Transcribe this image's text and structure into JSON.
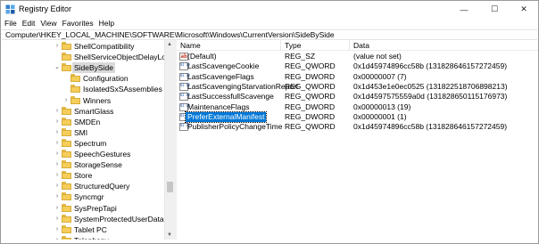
{
  "window": {
    "title": "Registry Editor",
    "minimize_glyph": "—",
    "maximize_glyph": "☐",
    "close_glyph": "✕"
  },
  "menu": [
    "File",
    "Edit",
    "View",
    "Favorites",
    "Help"
  ],
  "address": "Computer\\HKEY_LOCAL_MACHINE\\SOFTWARE\\Microsoft\\Windows\\CurrentVersion\\SideBySide",
  "tree": {
    "items": [
      {
        "label": "ShellCompatibility",
        "level": 0,
        "expandable": true,
        "expanded": false,
        "selected": false
      },
      {
        "label": "ShellServiceObjectDelayLoad",
        "level": 0,
        "expandable": false,
        "expanded": false,
        "selected": false
      },
      {
        "label": "SideBySide",
        "level": 0,
        "expandable": true,
        "expanded": true,
        "selected": true
      },
      {
        "label": "Configuration",
        "level": 1,
        "expandable": false,
        "expanded": false,
        "selected": false
      },
      {
        "label": "IsolatedSxSAssemblies",
        "level": 1,
        "expandable": false,
        "expanded": false,
        "selected": false
      },
      {
        "label": "Winners",
        "level": 1,
        "expandable": true,
        "expanded": false,
        "selected": false
      },
      {
        "label": "SmartGlass",
        "level": 0,
        "expandable": true,
        "expanded": false,
        "selected": false
      },
      {
        "label": "SMDEn",
        "level": 0,
        "expandable": true,
        "expanded": false,
        "selected": false
      },
      {
        "label": "SMI",
        "level": 0,
        "expandable": true,
        "expanded": false,
        "selected": false
      },
      {
        "label": "Spectrum",
        "level": 0,
        "expandable": true,
        "expanded": false,
        "selected": false
      },
      {
        "label": "SpeechGestures",
        "level": 0,
        "expandable": true,
        "expanded": false,
        "selected": false
      },
      {
        "label": "StorageSense",
        "level": 0,
        "expandable": true,
        "expanded": false,
        "selected": false
      },
      {
        "label": "Store",
        "level": 0,
        "expandable": true,
        "expanded": false,
        "selected": false
      },
      {
        "label": "StructuredQuery",
        "level": 0,
        "expandable": true,
        "expanded": false,
        "selected": false
      },
      {
        "label": "Syncmgr",
        "level": 0,
        "expandable": true,
        "expanded": false,
        "selected": false
      },
      {
        "label": "SysPrepTapi",
        "level": 0,
        "expandable": true,
        "expanded": false,
        "selected": false
      },
      {
        "label": "SystemProtectedUserData",
        "level": 0,
        "expandable": true,
        "expanded": false,
        "selected": false
      },
      {
        "label": "Tablet PC",
        "level": 0,
        "expandable": true,
        "expanded": false,
        "selected": false
      },
      {
        "label": "Telephony",
        "level": 0,
        "expandable": true,
        "expanded": false,
        "selected": false
      }
    ]
  },
  "list": {
    "columns": [
      "Name",
      "Type",
      "Data"
    ],
    "rows": [
      {
        "name": "(Default)",
        "type": "REG_SZ",
        "data": "(value not set)",
        "icon": "string-value-icon",
        "selected": false
      },
      {
        "name": "LastScavengeCookie",
        "type": "REG_QWORD",
        "data": "0x1d45974896cc58b (1318286461572724​59)",
        "icon": "binary-value-icon",
        "selected": false
      },
      {
        "name": "LastScavengeFlags",
        "type": "REG_DWORD",
        "data": "0x00000007 (7)",
        "icon": "binary-value-icon",
        "selected": false
      },
      {
        "name": "LastScavengingStarvationReport",
        "type": "REG_QWORD",
        "data": "0x1d453e1e0ec0525 (131822518706898213)",
        "icon": "binary-value-icon",
        "selected": false
      },
      {
        "name": "LastSuccessfullScavenge",
        "type": "REG_QWORD",
        "data": "0x1d4597575559a0d (131828650115176973)",
        "icon": "binary-value-icon",
        "selected": false
      },
      {
        "name": "MaintenanceFlags",
        "type": "REG_DWORD",
        "data": "0x00000013 (19)",
        "icon": "binary-value-icon",
        "selected": false
      },
      {
        "name": "PreferExternalManifest",
        "type": "REG_DWORD",
        "data": "0x00000001 (1)",
        "icon": "binary-value-icon",
        "selected": true
      },
      {
        "name": "PublisherPolicyChangeTime",
        "type": "REG_QWORD",
        "data": "0x1d45974896cc58b (131828646157272459)",
        "icon": "binary-value-icon",
        "selected": false
      }
    ]
  },
  "colors": {
    "selection": "#0078d7",
    "folder": "#f5cd5a",
    "tree_selected": "#d9d9d9"
  }
}
